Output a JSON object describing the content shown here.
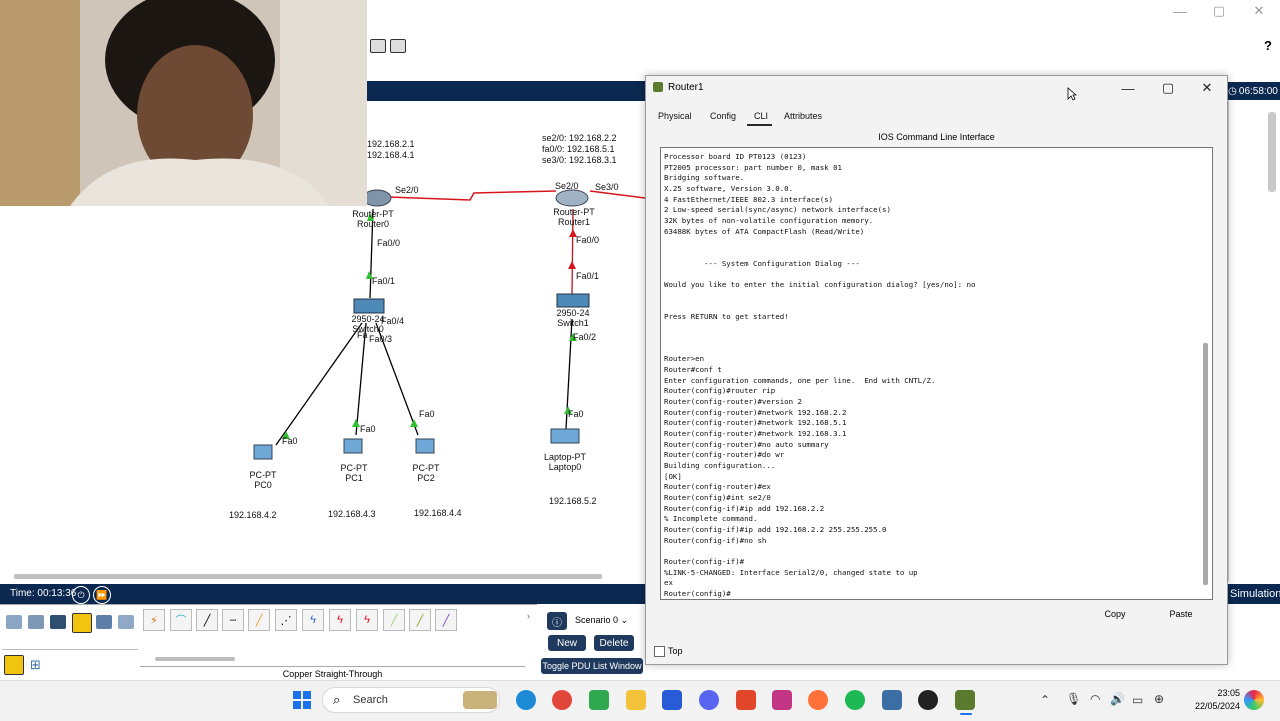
{
  "background_window": {
    "help_glyph": "?",
    "clock": "06:58:00",
    "simulation_tab": "Simulation",
    "window_controls": [
      "—",
      "▢",
      "✕"
    ]
  },
  "topology": {
    "router0_ips": [
      "192.168.2.1",
      "192.168.4.1"
    ],
    "router1_ips": [
      "se2/0: 192.168.2.2",
      "fa0/0: 192.168.5.1",
      "se3/0: 192.168.3.1"
    ],
    "router0": {
      "type": "Router-PT",
      "name": "Router0",
      "port_serial": "Se2/0",
      "port_fa": "Fa0/0"
    },
    "router1": {
      "type": "Router-PT",
      "name": "Router1",
      "port_serial_left": "Se2/0",
      "port_serial_right": "Se3/0",
      "port_fa": "Fa0/0"
    },
    "switch0": {
      "type": "2950-24",
      "name": "Switch0",
      "port_up": "Fa0/1",
      "port_pc1": "Fa0/3",
      "port_pc2": "Fa0/4",
      "port_pc0": "Fa"
    },
    "switch1": {
      "type": "2950-24",
      "name": "Switch1",
      "port_up": "Fa0/1",
      "port_down": "Fa0/2"
    },
    "pc0": {
      "type": "PC-PT",
      "name": "PC0",
      "port": "Fa0",
      "ip": "192.168.4.2"
    },
    "pc1": {
      "type": "PC-PT",
      "name": "PC1",
      "port": "Fa0",
      "ip": "192.168.4.3"
    },
    "pc2": {
      "type": "PC-PT",
      "name": "PC2",
      "port": "Fa0",
      "ip": "192.168.4.4"
    },
    "laptop0": {
      "type": "Laptop-PT",
      "name": "Laptop0",
      "port": "Fa0",
      "ip": "192.168.5.2"
    }
  },
  "time_bar": {
    "time": "Time: 00:13:36"
  },
  "bottom_panel": {
    "connection_label": "Copper Straight-Through",
    "scenario": "Scenario 0",
    "new_button": "New",
    "delete_button": "Delete",
    "toggle_pdu": "Toggle PDU List Window"
  },
  "router_window": {
    "title": "Router1",
    "tabs": [
      "Physical",
      "Config",
      "CLI",
      "Attributes"
    ],
    "active_tab": "CLI",
    "heading": "IOS Command Line Interface",
    "cli_output": "Processor board ID PT0123 (0123)\nPT2005 processor: part number 0, mask 01\nBridging software.\nX.25 software, Version 3.0.0.\n4 FastEthernet/IEEE 802.3 interface(s)\n2 Low-speed serial(sync/async) network interface(s)\n32K bytes of non-volatile configuration memory.\n63488K bytes of ATA CompactFlash (Read/Write)\n\n\n         --- System Configuration Dialog ---\n\nWould you like to enter the initial configuration dialog? [yes/no]: no\n\n\nPress RETURN to get started!\n\n\n\nRouter>en\nRouter#conf t\nEnter configuration commands, one per line.  End with CNTL/Z.\nRouter(config)#router rip\nRouter(config-router)#version 2\nRouter(config-router)#network 192.168.2.2\nRouter(config-router)#network 192.168.5.1\nRouter(config-router)#network 192.168.3.1\nRouter(config-router)#no auto summary\nRouter(config-router)#do wr\nBuilding configuration...\n[OK]\nRouter(config-router)#ex\nRouter(config)#int se2/0\nRouter(config-if)#ip add 192.168.2.2\n% Incomplete command.\nRouter(config-if)#ip add 192.168.2.2 255.255.255.0\nRouter(config-if)#no sh\n\nRouter(config-if)#\n%LINK-5-CHANGED: Interface Serial2/0, changed state to up\nex\nRouter(config)#",
    "copy_button": "Copy",
    "paste_button": "Paste",
    "top_checkbox_label": "Top"
  },
  "taskbar": {
    "search_placeholder": "Search",
    "time": "23:05",
    "date": "22/05/2024"
  },
  "colors": {
    "navy": "#0b2850",
    "serial_link": "#d8141d",
    "ethernet_link": "#000000",
    "port_up": "#2fbf2f"
  }
}
